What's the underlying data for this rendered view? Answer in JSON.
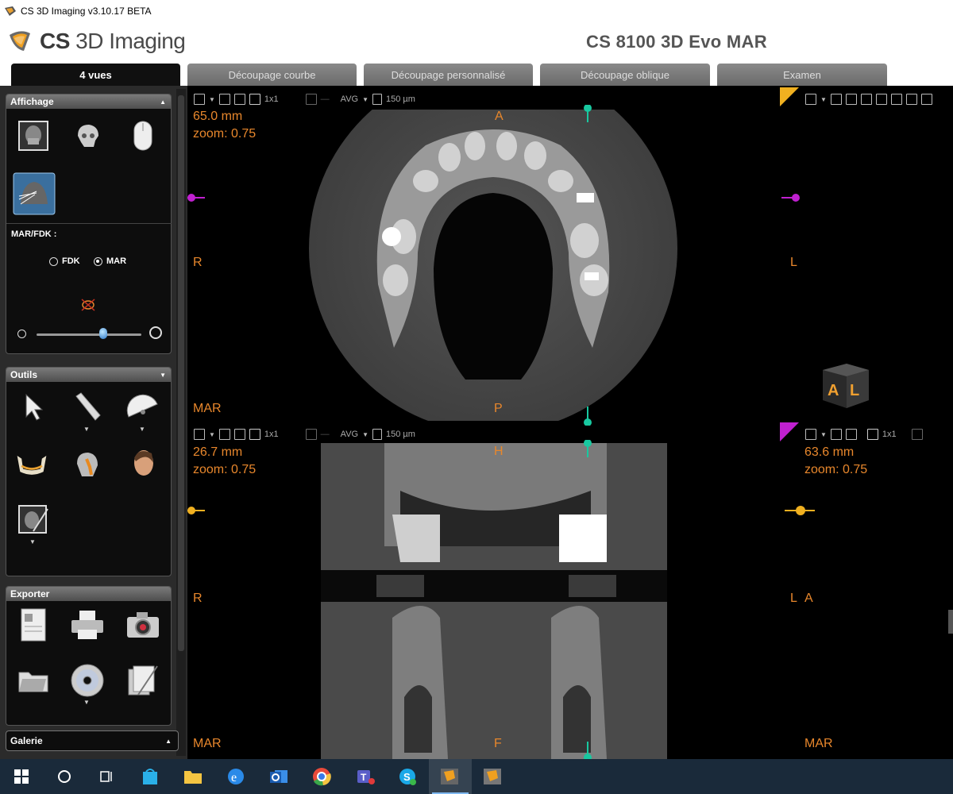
{
  "window": {
    "title": "CS 3D Imaging v3.10.17 BETA"
  },
  "header": {
    "logo_bold": "CS",
    "logo_rest": " 3D Imaging",
    "device": "CS 8100 3D Evo MAR"
  },
  "tabs": [
    {
      "label": "4 vues",
      "active": true
    },
    {
      "label": "Découpage courbe"
    },
    {
      "label": "Découpage personnalisé"
    },
    {
      "label": "Découpage oblique"
    },
    {
      "label": "Examen"
    }
  ],
  "panels": {
    "affichage": {
      "title": "Affichage",
      "marfdk_label": "MAR/FDK :",
      "fdk": "FDK",
      "mar": "MAR",
      "selected": "MAR"
    },
    "outils": {
      "title": "Outils"
    },
    "exporter": {
      "title": "Exporter"
    },
    "galerie": {
      "title": "Galerie"
    }
  },
  "toolbar": {
    "layout": "1x1",
    "mode": "AVG",
    "thickness": "150 µm"
  },
  "views": {
    "axial": {
      "distance": "65.0 mm",
      "zoom": "zoom: 0.75",
      "top": "A",
      "bottom": "P",
      "left": "R",
      "right": "L",
      "mode": "MAR"
    },
    "coronal": {
      "distance": "26.7 mm",
      "zoom": "zoom: 0.75",
      "top": "H",
      "bottom": "F",
      "left": "R",
      "right": "L",
      "mode": "MAR"
    },
    "sagittal": {
      "distance": "63.6 mm",
      "zoom": "zoom: 0.75",
      "right": "A",
      "mode": "MAR"
    }
  },
  "orientation_cube": {
    "face1": "A",
    "face2": "L"
  },
  "colors": {
    "accent": "#e8872c",
    "axial_marker": "#c020d0",
    "coronal_marker": "#f0b020",
    "sagittal_marker": "#18c8a0"
  },
  "taskbar_icons": [
    "windows-start-icon",
    "search-icon",
    "task-view-icon",
    "store-icon",
    "file-explorer-icon",
    "edge-icon",
    "outlook-icon",
    "chrome-icon",
    "teams-icon",
    "skype-icon",
    "cs-imaging-3d-icon",
    "cs-imaging-icon"
  ]
}
